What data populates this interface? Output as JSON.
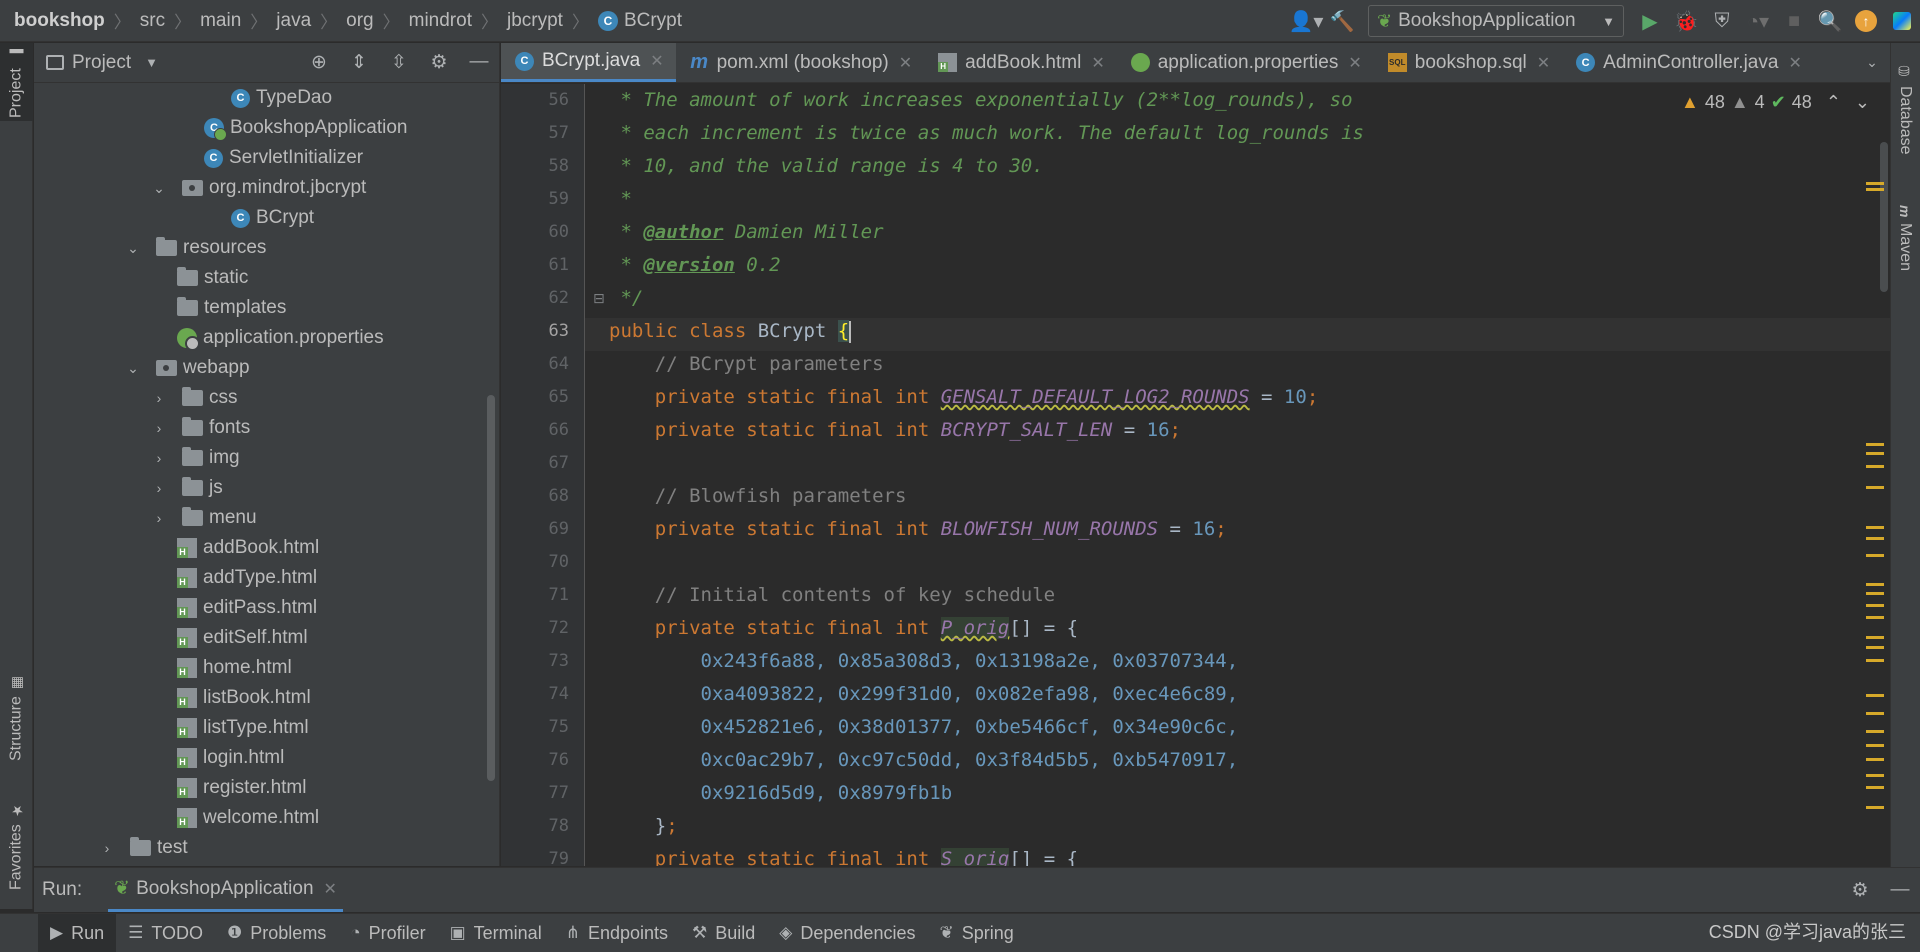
{
  "breadcrumb": [
    "bookshop",
    "src",
    "main",
    "java",
    "org",
    "mindrot",
    "jbcrypt",
    "BCrypt"
  ],
  "run_config": {
    "name": "BookshopApplication"
  },
  "left_stripe": {
    "project": "Project",
    "structure": "Structure",
    "favorites": "Favorites"
  },
  "right_stripe": {
    "database": "Database",
    "maven": "Maven"
  },
  "project_panel": {
    "title": "Project",
    "tree": [
      {
        "label": "TypeDao",
        "icon": "class-icon"
      },
      {
        "label": "BookshopApplication",
        "icon": "spring-boot-class-icon"
      },
      {
        "label": "ServletInitializer",
        "icon": "class-icon"
      },
      {
        "label": "org.mindrot.jbcrypt",
        "icon": "package-icon",
        "expanded": true
      },
      {
        "label": "BCrypt",
        "icon": "class-icon"
      },
      {
        "label": "resources",
        "icon": "resources-folder-icon",
        "expanded": true
      },
      {
        "label": "static",
        "icon": "folder-icon"
      },
      {
        "label": "templates",
        "icon": "folder-icon"
      },
      {
        "label": "application.properties",
        "icon": "properties-icon"
      },
      {
        "label": "webapp",
        "icon": "web-folder-icon",
        "expanded": true
      },
      {
        "label": "css",
        "icon": "folder-icon",
        "expanded": false
      },
      {
        "label": "fonts",
        "icon": "folder-icon",
        "expanded": false
      },
      {
        "label": "img",
        "icon": "folder-icon",
        "expanded": false
      },
      {
        "label": "js",
        "icon": "folder-icon",
        "expanded": false
      },
      {
        "label": "menu",
        "icon": "folder-icon",
        "expanded": false
      },
      {
        "label": "addBook.html",
        "icon": "html-icon"
      },
      {
        "label": "addType.html",
        "icon": "html-icon"
      },
      {
        "label": "editPass.html",
        "icon": "html-icon"
      },
      {
        "label": "editSelf.html",
        "icon": "html-icon"
      },
      {
        "label": "home.html",
        "icon": "html-icon"
      },
      {
        "label": "listBook.html",
        "icon": "html-icon"
      },
      {
        "label": "listType.html",
        "icon": "html-icon"
      },
      {
        "label": "login.html",
        "icon": "html-icon"
      },
      {
        "label": "register.html",
        "icon": "html-icon"
      },
      {
        "label": "welcome.html",
        "icon": "html-icon"
      },
      {
        "label": "test",
        "icon": "folder-icon",
        "expanded": false
      }
    ]
  },
  "tabs": [
    {
      "label": "BCrypt.java",
      "icon": "class-icon",
      "active": true
    },
    {
      "label": "pom.xml (bookshop)",
      "icon": "maven-icon"
    },
    {
      "label": "addBook.html",
      "icon": "html-icon"
    },
    {
      "label": "application.properties",
      "icon": "properties-icon"
    },
    {
      "label": "bookshop.sql",
      "icon": "sql-icon"
    },
    {
      "label": "AdminController.java",
      "icon": "class-icon"
    }
  ],
  "inspections": {
    "warnings": "48",
    "weak_warnings": "4",
    "typos": "48"
  },
  "code": {
    "line_numbers": [
      "56",
      "57",
      "58",
      "59",
      "60",
      "61",
      "62",
      "63",
      "64",
      "65",
      "66",
      "67",
      "68",
      "69",
      "70",
      "71",
      "72",
      "73",
      "74",
      "75",
      "76",
      "77",
      "78",
      "79"
    ],
    "current_line": "63",
    "l56": " * The amount of work increases exponentially (2**log_rounds), so",
    "l57": " * each increment is twice as much work. The default log_rounds is",
    "l58": " * 10, and the valid range is 4 to 30.",
    "l59": " *",
    "l60_a": " * ",
    "l60_tag": "@author",
    "l60_b": " Damien Miller",
    "l61_a": " * ",
    "l61_tag": "@version",
    "l61_b": " 0.2",
    "l62": " */",
    "l63_kw": "public class ",
    "l63_name": "BCrypt ",
    "l63_brace": "{",
    "l64": "    // BCrypt parameters",
    "l65_kw": "    private static final int ",
    "l65_const": "GENSALT_DEFAULT_LOG2_ROUNDS",
    "l65_eq": " = ",
    "l65_num": "10",
    "l65_end": ";",
    "l66_kw": "    private static final int ",
    "l66_const": "BCRYPT_SALT_LEN",
    "l66_eq": " = ",
    "l66_num": "16",
    "l66_end": ";",
    "l68": "    // Blowfish parameters",
    "l69_kw": "    private static final int ",
    "l69_const": "BLOWFISH_NUM_ROUNDS",
    "l69_eq": " = ",
    "l69_num": "16",
    "l69_end": ";",
    "l71": "    // Initial contents of key schedule",
    "l72_kw": "    private static final int ",
    "l72_const": "P_orig",
    "l72_rest": "[] = {",
    "l73": "        0x243f6a88, 0x85a308d3, 0x13198a2e, 0x03707344,",
    "l74": "        0xa4093822, 0x299f31d0, 0x082efa98, 0xec4e6c89,",
    "l75": "        0x452821e6, 0x38d01377, 0xbe5466cf, 0x34e90c6c,",
    "l76": "        0xc0ac29b7, 0xc97c50dd, 0x3f84d5b5, 0xb5470917,",
    "l77": "        0x9216d5d9, 0x8979fb1b",
    "l78_kw": "    }",
    "l78_end": ";",
    "l79_kw": "    private static final int ",
    "l79_const": "S_orig",
    "l79_rest": "[] = {"
  },
  "run_bar": {
    "label": "Run:",
    "config": "BookshopApplication"
  },
  "bottom_tabs": [
    "Run",
    "TODO",
    "Problems",
    "Profiler",
    "Terminal",
    "Endpoints",
    "Build",
    "Dependencies",
    "Spring"
  ],
  "watermark": "CSDN @学习java的张三"
}
